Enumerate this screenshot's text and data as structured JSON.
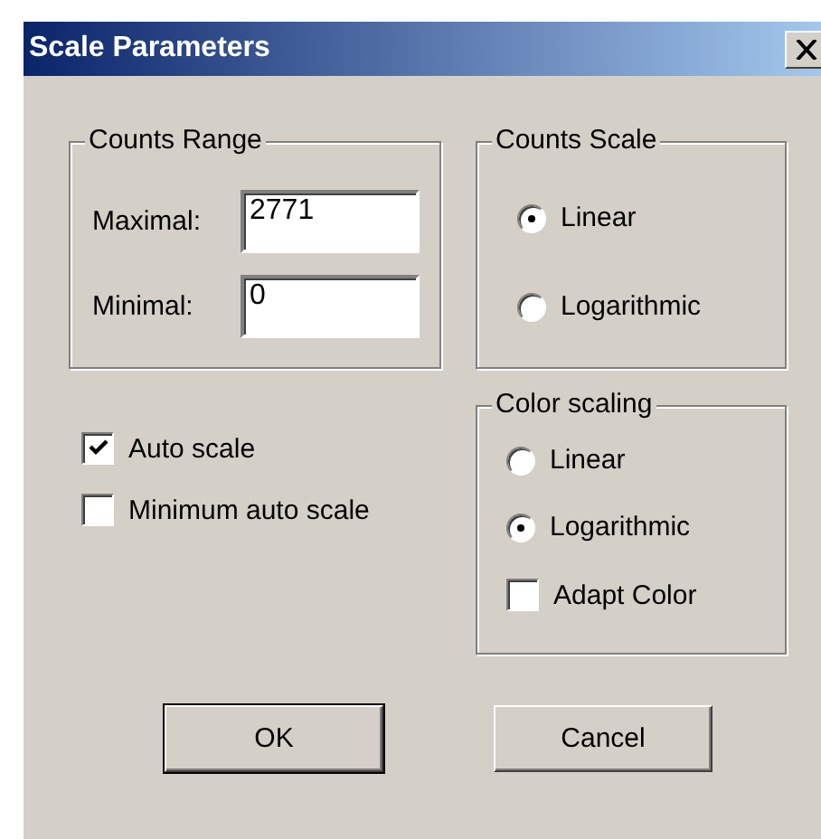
{
  "window": {
    "title": "Scale Parameters"
  },
  "counts_range": {
    "label": "Counts Range",
    "fields": [
      {
        "label": "Maximal:",
        "value": "2771"
      },
      {
        "label": "Minimal:",
        "value": "0"
      }
    ]
  },
  "counts_scale": {
    "label": "Counts Scale",
    "options": [
      {
        "label": "Linear",
        "selected": true
      },
      {
        "label": "Logarithmic",
        "selected": false
      }
    ]
  },
  "options": [
    {
      "label": "Auto scale",
      "checked": true
    },
    {
      "label": "Minimum auto scale",
      "checked": false
    }
  ],
  "color_scaling": {
    "label": "Color scaling",
    "items": [
      {
        "kind": "radio",
        "label": "Linear",
        "selected": false
      },
      {
        "kind": "radio",
        "label": "Logarithmic",
        "selected": true
      },
      {
        "kind": "checkbox",
        "label": "Adapt Color",
        "checked": false
      }
    ]
  },
  "buttons": [
    {
      "label": "OK",
      "default": true
    },
    {
      "label": "Cancel",
      "default": false
    }
  ]
}
